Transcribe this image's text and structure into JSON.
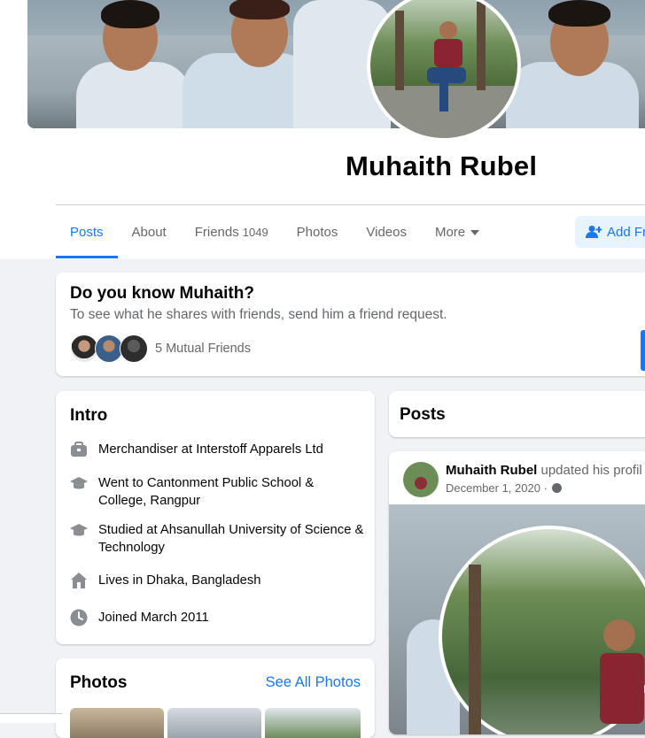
{
  "profile": {
    "name": "Muhaith Rubel"
  },
  "tabs": [
    {
      "label": "Posts",
      "active": true
    },
    {
      "label": "About"
    },
    {
      "label": "Friends",
      "count": "1049"
    },
    {
      "label": "Photos"
    },
    {
      "label": "Videos"
    },
    {
      "label": "More"
    }
  ],
  "actions": {
    "add_friend": "Add Fr"
  },
  "know_card": {
    "title": "Do you know Muhaith?",
    "subtitle": "To see what he shares with friends, send him a friend request.",
    "mutual": "5 Mutual Friends"
  },
  "intro": {
    "title": "Intro",
    "items": [
      {
        "icon": "briefcase-icon",
        "prefix": "Merchandiser at ",
        "bold": "Interstoff Apparels Ltd"
      },
      {
        "icon": "graduation-cap-icon",
        "prefix": "Went to ",
        "bold": "Cantonment Public School & College, Rangpur"
      },
      {
        "icon": "graduation-cap-icon",
        "prefix": "Studied at Ahsanullah University of Science & Technology",
        "bold": ""
      },
      {
        "icon": "home-icon",
        "prefix": "Lives in ",
        "bold": "Dhaka, Bangladesh"
      },
      {
        "icon": "clock-icon",
        "prefix": "Joined March 2011",
        "bold": ""
      }
    ]
  },
  "photos_card": {
    "title": "Photos",
    "see_all": "See All Photos"
  },
  "posts": {
    "title": "Posts",
    "post": {
      "author": "Muhaith Rubel",
      "action": " updated his profil",
      "date": "December 1, 2020 ·"
    }
  },
  "colors": {
    "accent": "#1877f2",
    "bg": "#f0f2f5"
  }
}
